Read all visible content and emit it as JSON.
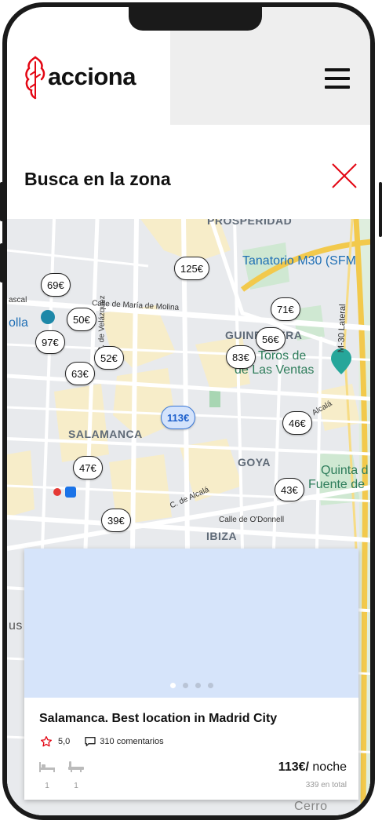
{
  "header": {
    "logo_text": "acciona",
    "menu_icon": "hamburger-menu-icon"
  },
  "search": {
    "title": "Busca en la zona",
    "close_icon": "close-x-icon"
  },
  "map": {
    "labels": {
      "prosperidad": "PROSPERIDAD",
      "tanatorio": "Tanatorio M30 (SFM",
      "maria_molina": "Calle de María de Molina",
      "guindalera": "GUINDALERA",
      "toros_1": "de Toros de",
      "toros_2": "de Las Ventas",
      "m30": "M-30 Lateral",
      "velazquez": "C. de Velázquez",
      "salamanca": "SALAMANCA",
      "goya": "GOYA",
      "quinta_1": "Quinta d",
      "quinta_2": "Fuente de",
      "alcala_1": "C. de Alcalá",
      "alcala_2": "Alcalá",
      "odonnell": "Calle de O'Donnell",
      "ibiza": "IBIZA",
      "olla": "olla",
      "ascal": "ascal",
      "cerro": "Cerro",
      "us": "us"
    },
    "pins": {
      "p125": "125€",
      "p69": "69€",
      "p71": "71€",
      "p50": "50€",
      "p97": "97€",
      "p56": "56€",
      "p83": "83€",
      "p52": "52€",
      "p63": "63€",
      "p113": "113€",
      "p46": "46€",
      "p47": "47€",
      "p43": "43€",
      "p39": "39€"
    }
  },
  "card": {
    "title": "Salamanca. Best  location in Madrid City",
    "rating": "5,0",
    "reviews": "310 comentarios",
    "beds": "1",
    "baths": "1",
    "price": "113€/",
    "price_unit": " noche",
    "total": "339 en total",
    "carousel_slides": 4,
    "carousel_active": 1,
    "colors": {
      "accent": "#e30613",
      "pin_active": "#3a78d8",
      "image_placeholder": "#d6e4fa"
    }
  }
}
